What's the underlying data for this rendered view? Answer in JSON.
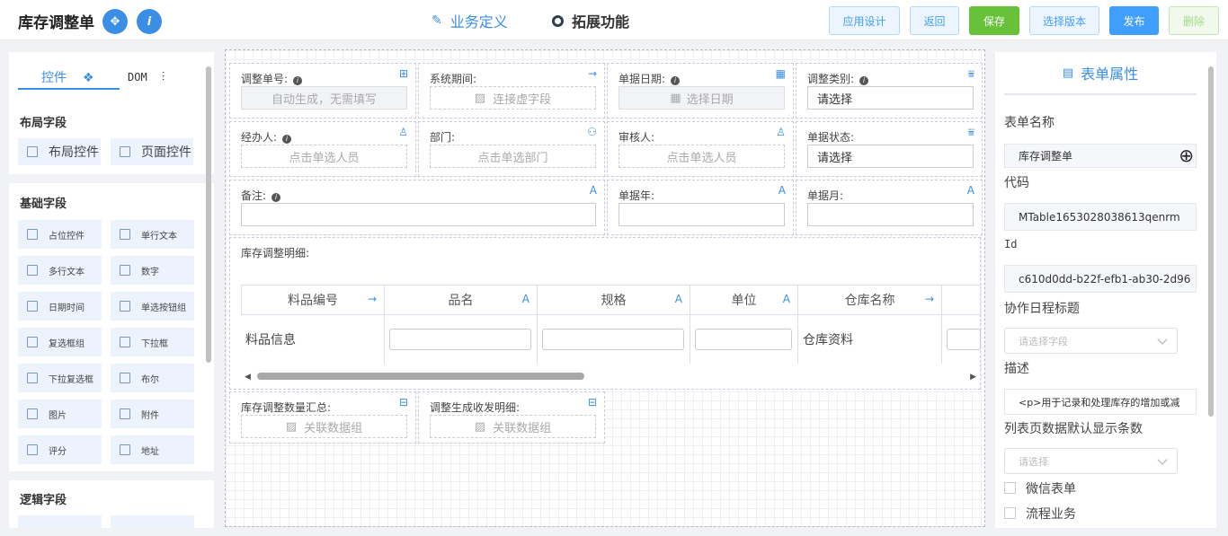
{
  "header": {
    "title": "库存调整单",
    "nav_business": "业务定义",
    "nav_extend": "拓展功能",
    "buttons": {
      "app_design": "应用设计",
      "back": "返回",
      "save": "保存",
      "select_version": "选择版本",
      "publish": "发布",
      "delete": "删除"
    }
  },
  "left": {
    "tab_controls": "控件",
    "tab_dom": "DOM",
    "layout_title": "布局字段",
    "layout_items": [
      "布局控件",
      "页面控件"
    ],
    "basic_title": "基础字段",
    "basic_items": [
      "占位控件",
      "单行文本",
      "多行文本",
      "数字",
      "日期时间",
      "单选按钮组",
      "复选框组",
      "下拉框",
      "下拉复选框",
      "布尔",
      "图片",
      "附件",
      "评分",
      "地址"
    ],
    "logic_title": "逻辑字段"
  },
  "form": {
    "fields": [
      {
        "label": "调整单号:",
        "value": "自动生成，无需填写"
      },
      {
        "label": "系统期间:",
        "value": "连接虚字段"
      },
      {
        "label": "单据日期:",
        "value": "选择日期"
      },
      {
        "label": "调整类别:",
        "value": "请选择"
      },
      {
        "label": "经办人:",
        "value": "点击单选人员"
      },
      {
        "label": "部门:",
        "value": "点击单选部门"
      },
      {
        "label": "审核人:",
        "value": "点击单选人员"
      },
      {
        "label": "单据状态:",
        "value": "请选择"
      },
      {
        "label": "备注:",
        "value": ""
      },
      {
        "label": "单据年:",
        "value": ""
      },
      {
        "label": "单据月:",
        "value": ""
      }
    ],
    "detail_title": "库存调整明细:",
    "columns": [
      "料品编号",
      "品名",
      "规格",
      "单位",
      "仓库名称"
    ],
    "row_cells": [
      "料品信息",
      "仓库资料"
    ],
    "summary": [
      {
        "label": "库存调整数量汇总:",
        "value": "关联数据组"
      },
      {
        "label": "调整生成收发明细:",
        "value": "关联数据组"
      }
    ]
  },
  "props": {
    "title": "表单属性",
    "form_name_label": "表单名称",
    "form_name": "库存调整单",
    "code_label": "代码",
    "code": "MTable1653028038613qenrm",
    "id_label": "Id",
    "id": "c610d0dd-b22f-efb1-ab30-2d96",
    "calendar_label": "协作日程标题",
    "calendar_placeholder": "请选择字段",
    "desc_label": "描述",
    "desc": "<p>用于记录和处理库存的增加或减",
    "page_size_label": "列表页数据默认显示条数",
    "page_size_placeholder": "请选择",
    "wechat_label": "微信表单",
    "workflow_label": "流程业务"
  }
}
